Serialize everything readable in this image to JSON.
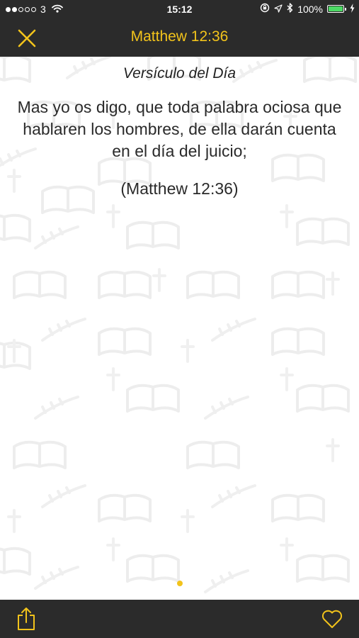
{
  "status_bar": {
    "signal_filled": 2,
    "signal_total": 5,
    "carrier": "3",
    "time": "15:12",
    "battery_text": "100%",
    "battery_level": 1.0,
    "icons": [
      "wifi-icon",
      "orientation-lock-icon",
      "location-icon",
      "bluetooth-icon",
      "battery-icon",
      "charging-icon"
    ]
  },
  "nav": {
    "title": "Matthew 12:36",
    "close_icon": "close-icon"
  },
  "verse": {
    "heading": "Versículo del Día",
    "text": "Mas yo os digo, que toda palabra ociosa que hablaren los hombres, de ella darán cuenta en el día del juicio;",
    "reference": "(Matthew 12:36)"
  },
  "pager": {
    "total": 1,
    "active": 1
  },
  "toolbar": {
    "share_icon": "share-icon",
    "favorite_icon": "heart-icon"
  },
  "colors": {
    "accent": "#f2c31b",
    "bar_background": "#2b2b2b",
    "battery_fill": "#4cd964",
    "pattern": "#f2f2f2"
  }
}
